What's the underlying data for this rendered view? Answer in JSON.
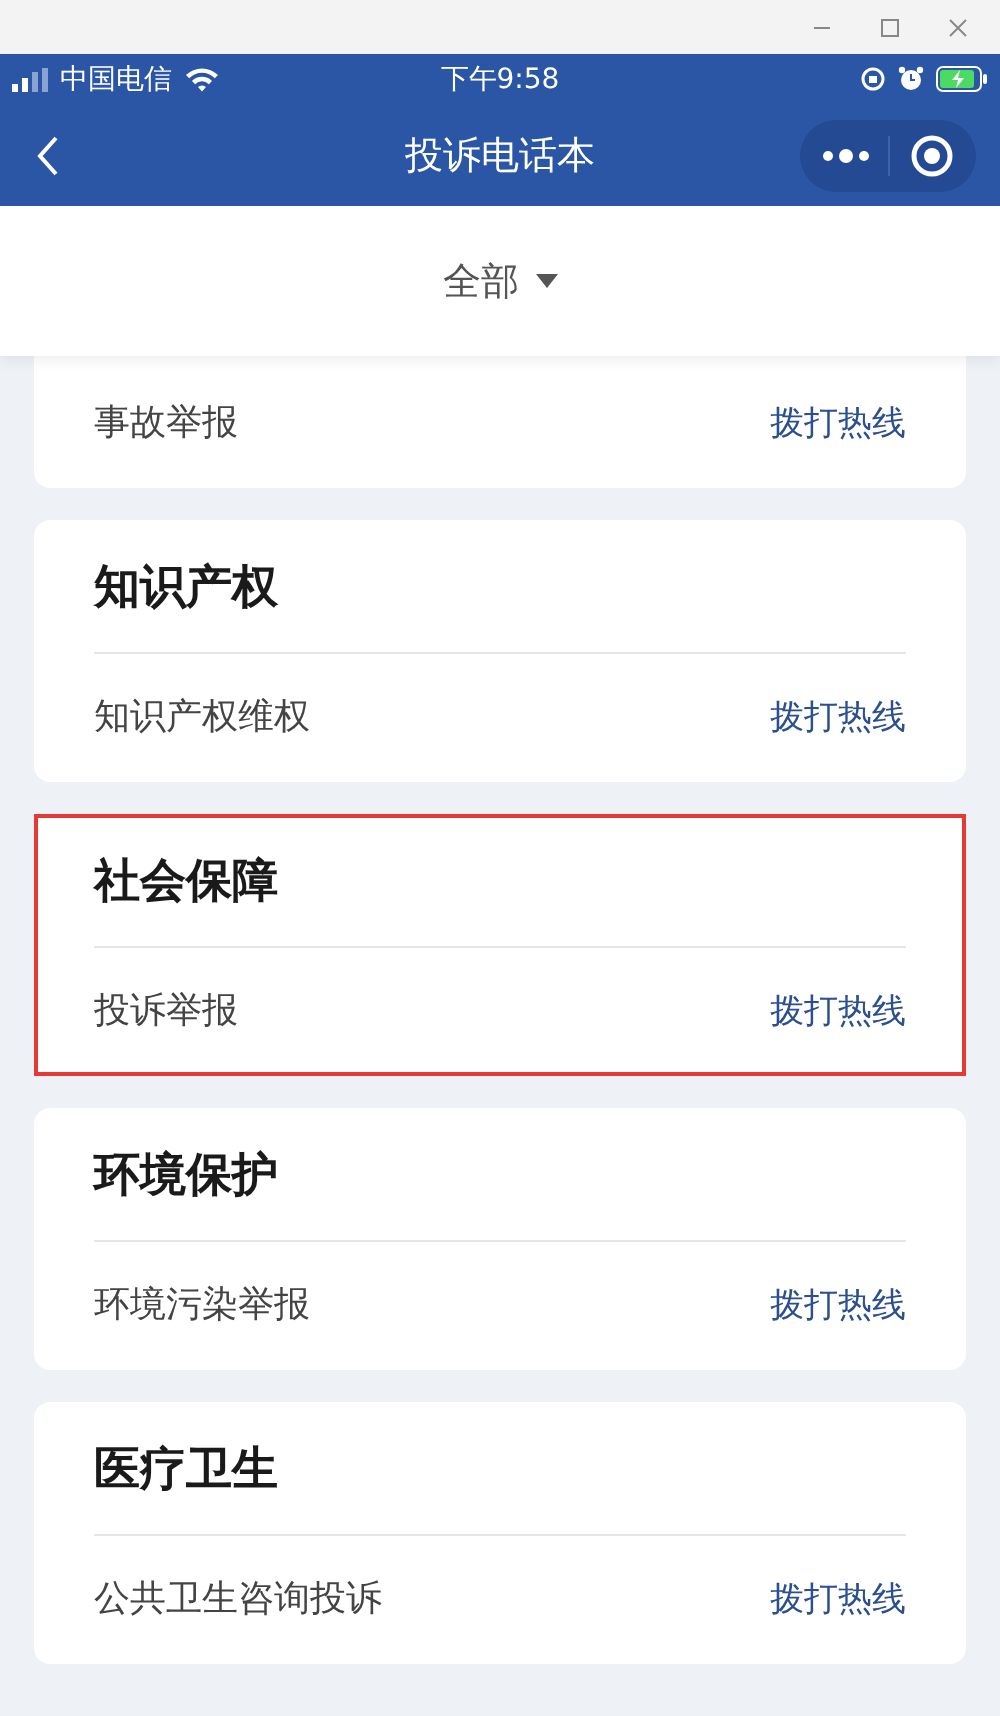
{
  "status_bar": {
    "carrier": "中国电信",
    "time": "下午9:58"
  },
  "nav": {
    "title": "投诉电话本"
  },
  "filter": {
    "label": "全部"
  },
  "categories": [
    {
      "highlighted": false,
      "items": [
        {
          "name": "事故举报",
          "action": "拨打热线"
        }
      ]
    },
    {
      "title": "知识产权",
      "highlighted": false,
      "items": [
        {
          "name": "知识产权维权",
          "action": "拨打热线"
        }
      ]
    },
    {
      "title": "社会保障",
      "highlighted": true,
      "items": [
        {
          "name": "投诉举报",
          "action": "拨打热线"
        }
      ]
    },
    {
      "title": "环境保护",
      "highlighted": false,
      "items": [
        {
          "name": "环境污染举报",
          "action": "拨打热线"
        }
      ]
    },
    {
      "title": "医疗卫生",
      "highlighted": false,
      "items": [
        {
          "name": "公共卫生咨询投诉",
          "action": "拨打热线"
        }
      ]
    }
  ]
}
